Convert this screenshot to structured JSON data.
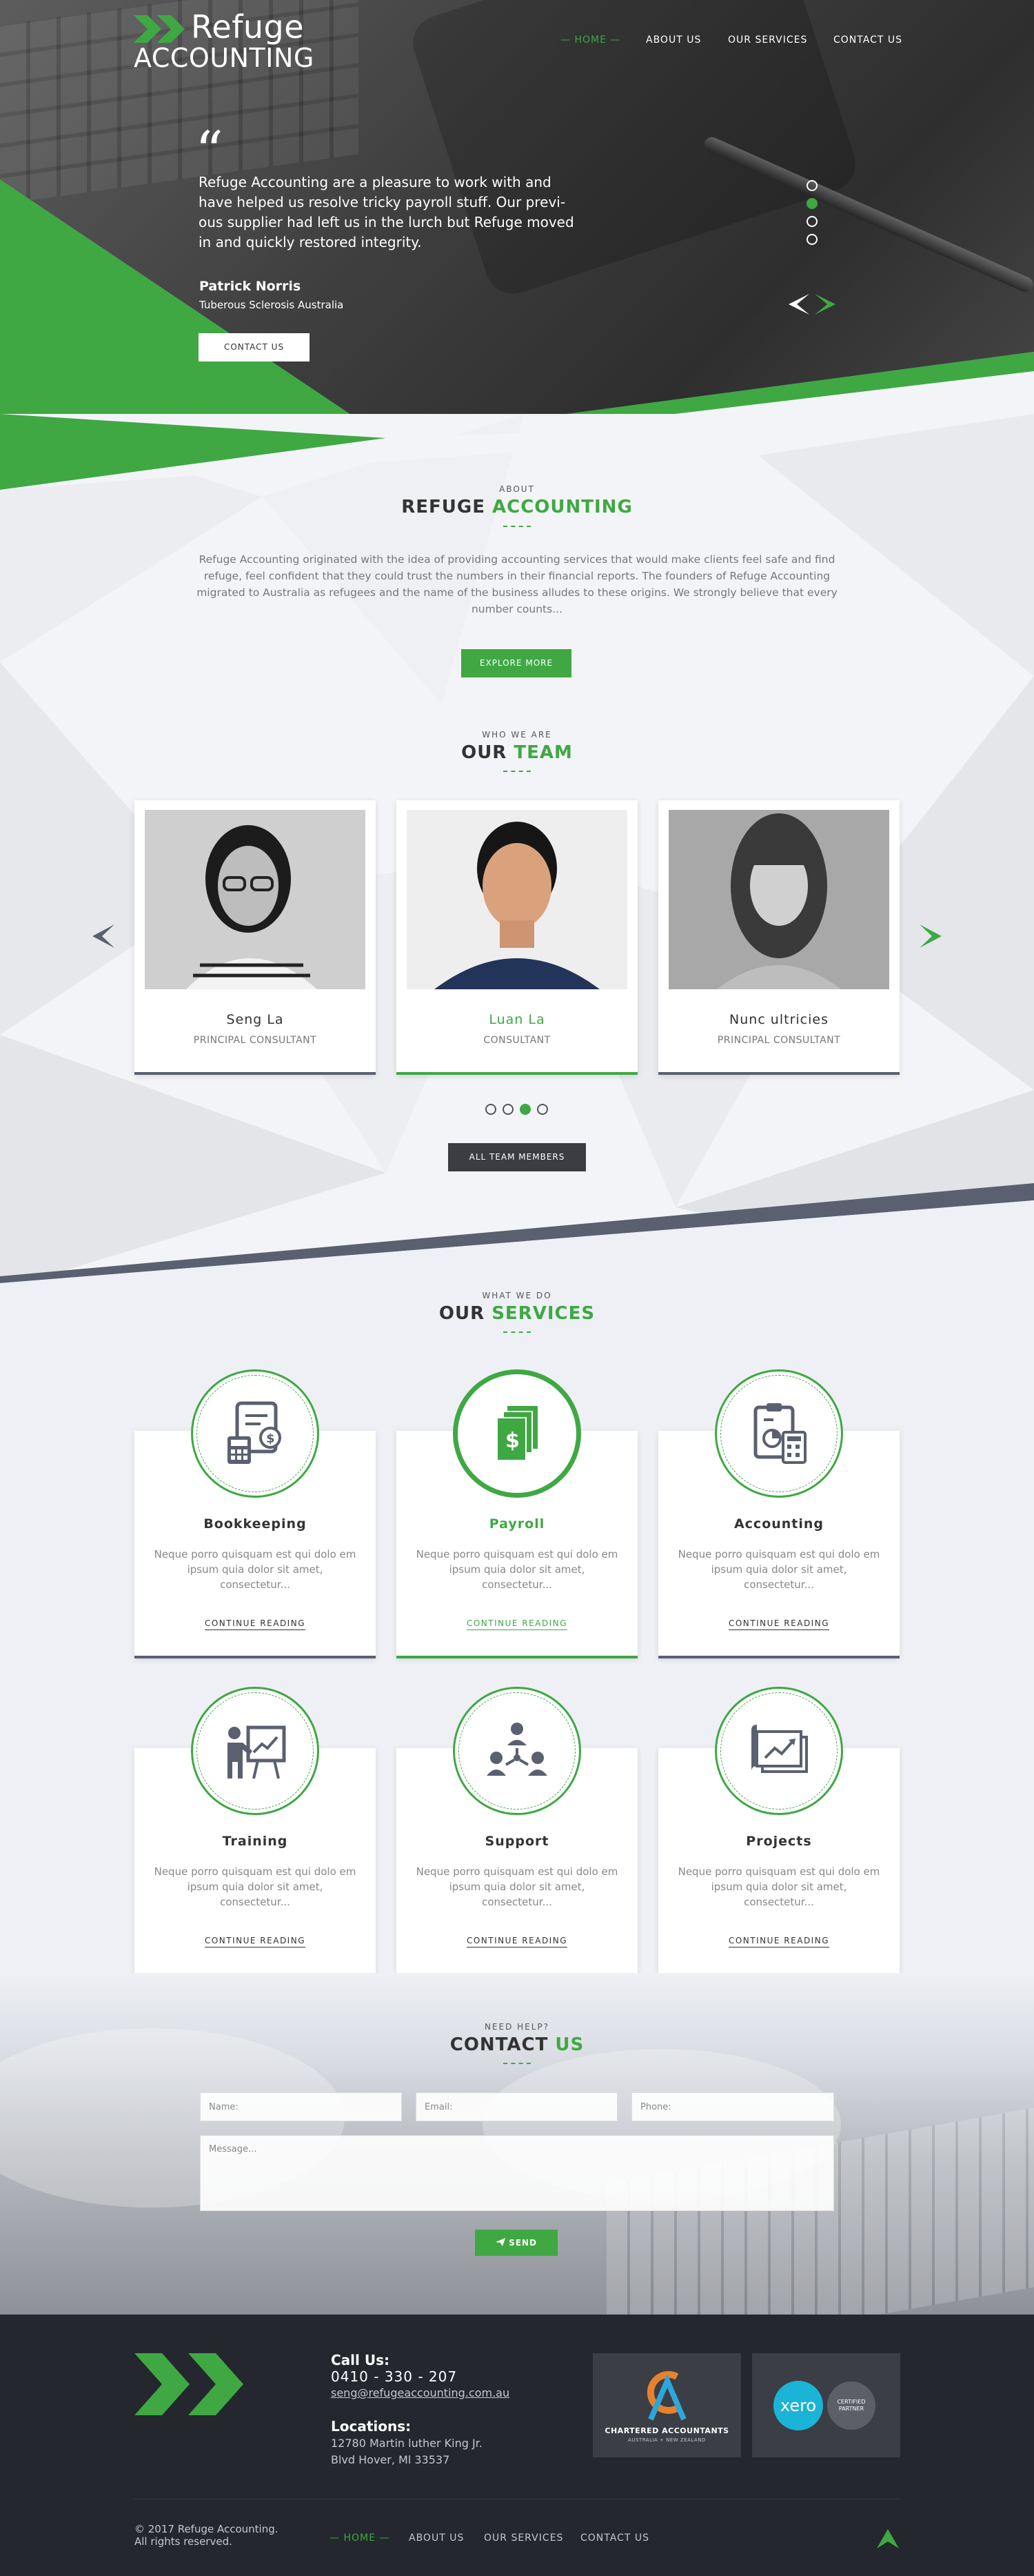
{
  "brand": {
    "title": "Refuge",
    "subtitle": "ACCOUNTING"
  },
  "nav": [
    {
      "label": "HOME"
    },
    {
      "label": "ABOUT US"
    },
    {
      "label": "OUR SERVICES"
    },
    {
      "label": "CONTACT US"
    }
  ],
  "hero": {
    "quote_mark": "“",
    "quote": "Refuge Accounting are a pleasure to work with and have helped us resolve tricky payroll stuff. Our previ-ous supplier had left us in the lurch but Refuge moved in and quickly restored integrity.",
    "author": "Patrick Norris",
    "organization": "Tuberous Sclerosis Australia",
    "button": "CONTACT US",
    "slides_total": 4,
    "slide_active": 2
  },
  "about": {
    "kicker": "ABOUT",
    "title_a": "REFUGE ",
    "title_b": "ACCOUNTING",
    "text": "Refuge Accounting originated with the idea of providing accounting services that would make clients feel safe and find refuge, feel confident that they could trust the numbers in their financial reports. The founders of Refuge Accounting migrated to Australia as refugees and the name of the business alludes to these origins. We strongly believe that every number counts...",
    "button": "EXPLORE MORE"
  },
  "team": {
    "kicker": "WHO WE ARE",
    "title_a": "OUR ",
    "title_b": "TEAM",
    "members": [
      {
        "name": "Seng La",
        "role": "PRINCIPAL CONSULTANT"
      },
      {
        "name": "Luan La",
        "role": "CONSULTANT"
      },
      {
        "name": "Nunc ultricies",
        "role": "PRINCIPAL CONSULTANT"
      }
    ],
    "pages_total": 4,
    "page_active": 3,
    "button": "ALL TEAM MEMBERS"
  },
  "services": {
    "kicker": "WHAT WE DO",
    "title_a": "OUR ",
    "title_b": "SERVICES",
    "items": [
      {
        "title": "Bookkeeping",
        "desc": "Neque porro quisquam est qui dolo em ipsum quia dolor sit amet, consectetur...",
        "link": "CONTINUE READING",
        "icon": "bookkeeping-icon"
      },
      {
        "title": "Payroll",
        "desc": "Neque porro quisquam est qui dolo em ipsum quia dolor sit amet, consectetur...",
        "link": "CONTINUE READING",
        "icon": "payroll-icon"
      },
      {
        "title": "Accounting",
        "desc": "Neque porro quisquam est qui dolo em ipsum quia dolor sit amet, consectetur...",
        "link": "CONTINUE READING",
        "icon": "accounting-icon"
      },
      {
        "title": "Training",
        "desc": "Neque porro quisquam est qui dolo em ipsum quia dolor sit amet, consectetur...",
        "link": "CONTINUE READING",
        "icon": "training-icon"
      },
      {
        "title": "Support",
        "desc": "Neque porro quisquam est qui dolo em ipsum quia dolor sit amet, consectetur...",
        "link": "CONTINUE READING",
        "icon": "support-icon"
      },
      {
        "title": "Projects",
        "desc": "Neque porro quisquam est qui dolo em ipsum quia dolor sit amet, consectetur...",
        "link": "CONTINUE READING",
        "icon": "projects-icon"
      }
    ]
  },
  "contact": {
    "kicker": "NEED HELP?",
    "title_a": "CONTACT ",
    "title_b": "US",
    "name_placeholder": "Name:",
    "email_placeholder": "Email:",
    "phone_placeholder": "Phone:",
    "message_placeholder": "Message...",
    "send": "SEND"
  },
  "footer": {
    "call_heading": "Call Us:",
    "phone": "0410 - 330 - 207",
    "email": "seng@refugeaccounting.com.au",
    "location_heading": "Locations:",
    "address_1": "12780 Martin luther King Jr.",
    "address_2": "Blvd Hover, Ml 33537",
    "badge1_title": "CHARTERED ACCOUNTANTS",
    "badge1_sub": "AUSTRALIA + NEW ZEALAND",
    "badge2_logo": "xero",
    "badge2_text": "CERTIFIED PARTNER",
    "copyright_1": "© 2017 Refuge Accounting.",
    "copyright_2": "All rights reserved.",
    "nav": [
      {
        "label": "HOME"
      },
      {
        "label": "ABOUT US"
      },
      {
        "label": "OUR SERVICES"
      },
      {
        "label": "CONTACT US"
      }
    ]
  },
  "colors": {
    "accent": "#3fa843",
    "dark": "#24272d",
    "slate": "#5a6070"
  }
}
